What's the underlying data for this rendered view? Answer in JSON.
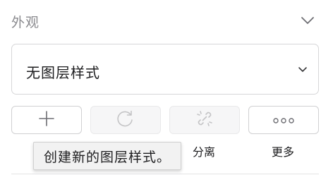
{
  "panel": {
    "section_title": "外观",
    "collapse_icon": "chevron-down-icon"
  },
  "layer_style_select": {
    "value": "无图层样式",
    "chevron_icon": "chevron-down-icon"
  },
  "actions": [
    {
      "icon": "plus-icon",
      "state": "enabled",
      "label": ""
    },
    {
      "icon": "refresh-icon",
      "state": "disabled",
      "label": ""
    },
    {
      "icon": "broken-link-icon",
      "state": "disabled",
      "label": "分离"
    },
    {
      "icon": "ellipsis-icon",
      "state": "enabled",
      "label": "更多"
    }
  ],
  "tooltip": {
    "text": "创建新的图层样式。"
  },
  "colors": {
    "title_gray": "#8a8a8e",
    "border": "#d0d0d2",
    "disabled_icon": "#c4c4c6",
    "enabled_icon": "#6e6e73"
  }
}
